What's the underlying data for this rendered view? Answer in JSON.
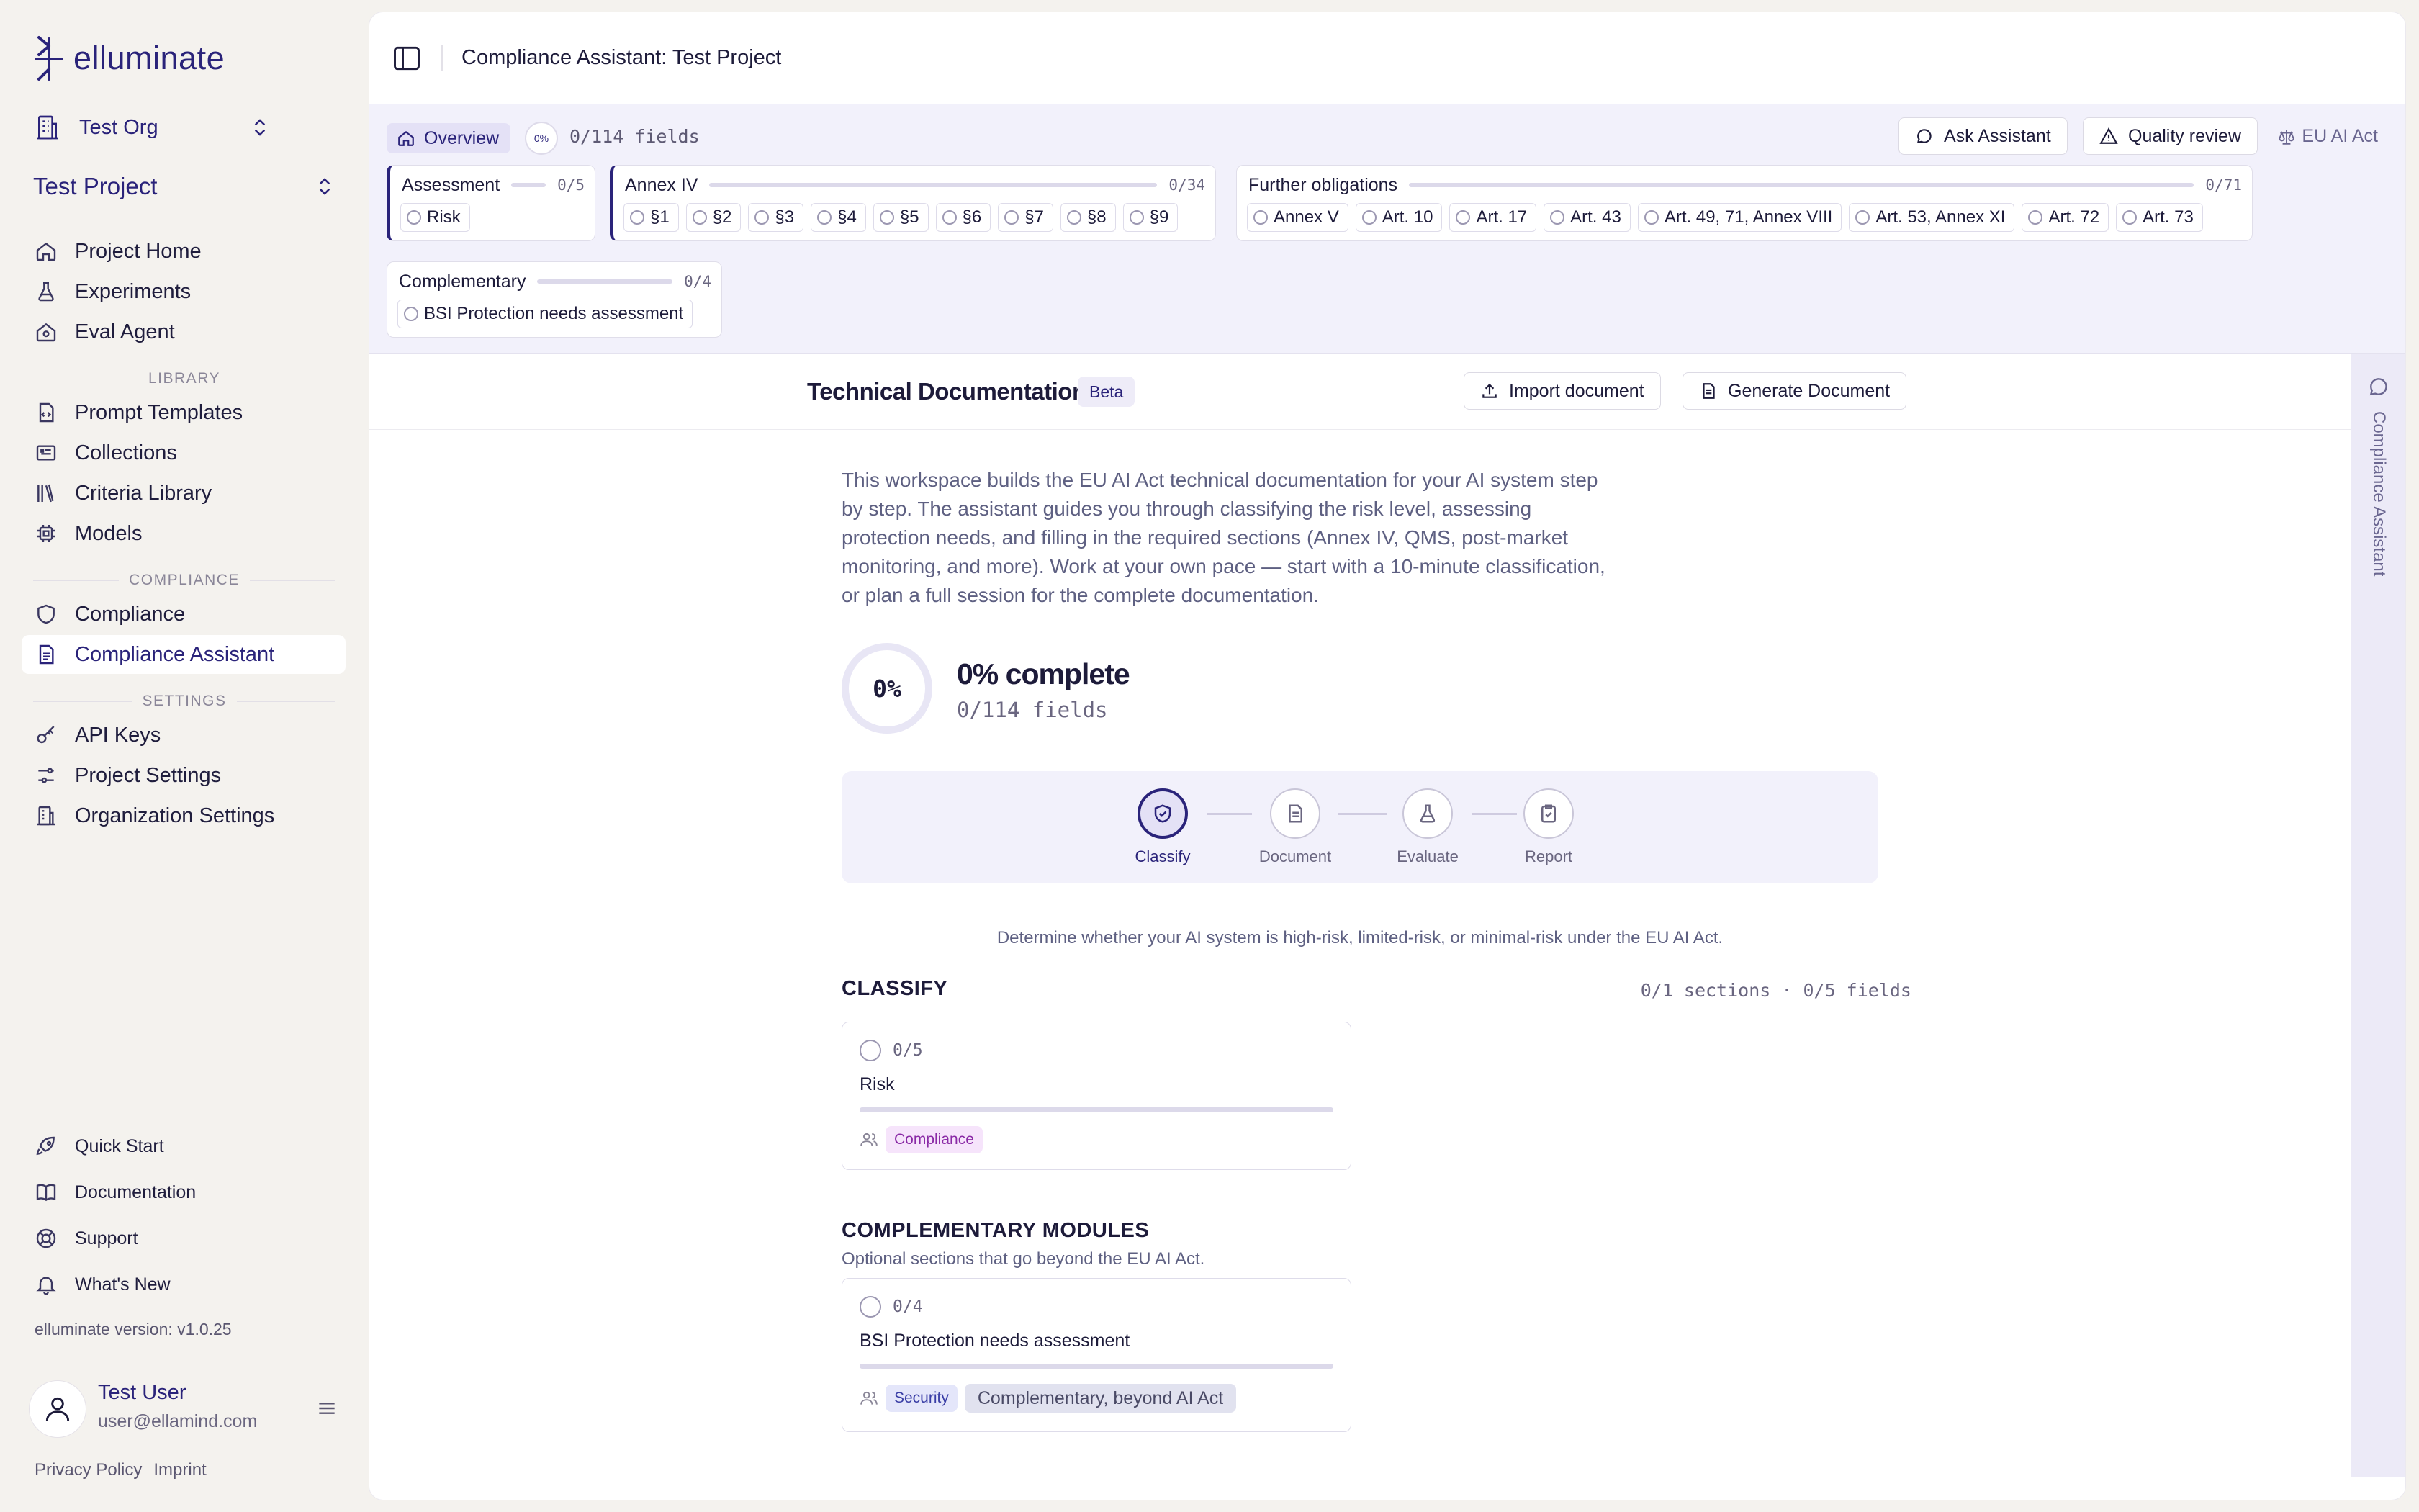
{
  "app": {
    "logo": "elluminate"
  },
  "sidebar": {
    "org": "Test Org",
    "project": "Test Project",
    "main_items": [
      {
        "label": "Project Home",
        "icon": "home-icon"
      },
      {
        "label": "Experiments",
        "icon": "flask-icon"
      },
      {
        "label": "Eval Agent",
        "icon": "agent-icon"
      }
    ],
    "library_label": "LIBRARY",
    "library_items": [
      {
        "label": "Prompt Templates",
        "icon": "template-icon"
      },
      {
        "label": "Collections",
        "icon": "folder-icon"
      },
      {
        "label": "Criteria Library",
        "icon": "books-icon"
      },
      {
        "label": "Models",
        "icon": "chip-icon"
      }
    ],
    "compliance_label": "COMPLIANCE",
    "compliance_items": [
      {
        "label": "Compliance",
        "icon": "shield-icon"
      },
      {
        "label": "Compliance Assistant",
        "icon": "document-icon",
        "active": true
      }
    ],
    "settings_label": "SETTINGS",
    "settings_items": [
      {
        "label": "API Keys",
        "icon": "key-icon"
      },
      {
        "label": "Project Settings",
        "icon": "sliders-icon"
      },
      {
        "label": "Organization Settings",
        "icon": "building-icon"
      }
    ],
    "bottom_items": [
      {
        "label": "Quick Start",
        "icon": "rocket-icon"
      },
      {
        "label": "Documentation",
        "icon": "book-icon"
      },
      {
        "label": "Support",
        "icon": "lifebuoy-icon"
      },
      {
        "label": "What's New",
        "icon": "bell-icon"
      }
    ],
    "version": "elluminate version: v1.0.25",
    "user": {
      "name": "Test User",
      "email": "user@ellamind.com"
    },
    "footer": {
      "privacy": "Privacy Policy",
      "imprint": "Imprint"
    }
  },
  "header": {
    "title": "Compliance Assistant: Test Project"
  },
  "fields": {
    "overview_label": "Overview",
    "spinner_text": "0%",
    "overview_count": "0/114 fields",
    "ask_assistant": "Ask Assistant",
    "quality_review": "Quality review",
    "eu_ai_act": "EU AI Act",
    "groups": {
      "assessment": {
        "title": "Assessment",
        "count": "0/5",
        "chips": [
          "Risk"
        ]
      },
      "annex": {
        "title": "Annex IV",
        "count": "0/34",
        "chips": [
          "§1",
          "§2",
          "§3",
          "§4",
          "§5",
          "§6",
          "§7",
          "§8",
          "§9"
        ]
      },
      "further": {
        "title": "Further obligations",
        "count": "0/71",
        "chips": [
          "Annex V",
          "Art. 10",
          "Art. 17",
          "Art. 43",
          "Art. 49, 71, Annex VIII",
          "Art. 53, Annex XI",
          "Art. 72",
          "Art. 73"
        ]
      },
      "complementary": {
        "title": "Complementary",
        "count": "0/4",
        "chips": [
          "BSI Protection needs assessment"
        ]
      }
    }
  },
  "doc": {
    "title": "Technical Documentation",
    "beta": "Beta",
    "import_label": "Import document",
    "generate_label": "Generate Document",
    "rail_label": "Compliance Assistant",
    "intro": "This workspace builds the EU AI Act technical documentation for your AI system step by step. The assistant guides you through classifying the risk level, assessing protection needs, and filling in the required sections (Annex IV, QMS, post-market monitoring, and more). Work at your own pace — start with a 10-minute classification, or plan a full session for the complete documentation.",
    "progress": {
      "ring": "0%",
      "title": "0% complete",
      "sub": "0/114 fields",
      "fraction": 0
    },
    "steps": [
      {
        "label": "Classify",
        "icon": "shield-check-icon",
        "active": true
      },
      {
        "label": "Document",
        "icon": "document-icon",
        "active": false
      },
      {
        "label": "Evaluate",
        "icon": "flask-icon",
        "active": false
      },
      {
        "label": "Report",
        "icon": "clipboard-icon",
        "active": false
      }
    ],
    "step_desc": "Determine whether your AI system is high-risk, limited-risk, or minimal-risk under the EU AI Act.",
    "classify": {
      "heading": "CLASSIFY",
      "meta": "0/1 sections · 0/5 fields",
      "card": {
        "count": "0/5",
        "name": "Risk",
        "tags": [
          "Compliance"
        ]
      }
    },
    "complementary": {
      "heading": "COMPLEMENTARY MODULES",
      "sub": "Optional sections that go beyond the EU AI Act.",
      "card": {
        "count": "0/4",
        "name": "BSI Protection needs assessment",
        "tags": [
          "Security",
          "Complementary, beyond AI Act"
        ]
      }
    }
  },
  "colors": {
    "brand": "#2a237a",
    "sidebar_bg": "#f4f2ee",
    "tint": "#f2f1fb"
  }
}
